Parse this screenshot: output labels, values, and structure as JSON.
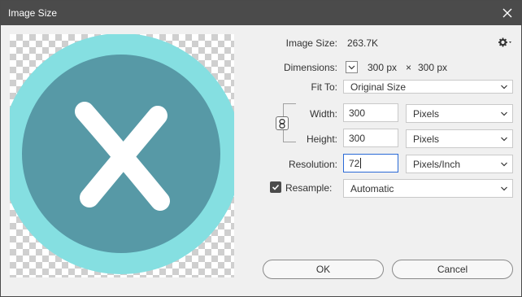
{
  "window": {
    "title": "Image Size"
  },
  "image_size": {
    "label": "Image Size:",
    "value": "263.7K"
  },
  "dimensions": {
    "label": "Dimensions:",
    "width": "300 px",
    "separator": "×",
    "height": "300 px"
  },
  "fit_to": {
    "label": "Fit To:",
    "value": "Original Size"
  },
  "width": {
    "label": "Width:",
    "value": "300",
    "unit": "Pixels"
  },
  "height": {
    "label": "Height:",
    "value": "300",
    "unit": "Pixels"
  },
  "resolution": {
    "label": "Resolution:",
    "value": "72",
    "unit": "Pixels/Inch"
  },
  "resample": {
    "label": "Resample:",
    "checked": true,
    "value": "Automatic"
  },
  "buttons": {
    "ok": "OK",
    "cancel": "Cancel"
  },
  "colors": {
    "titlebar": "#4b4b4b",
    "circle_outer": "#85dfe1",
    "circle_inner": "#5799a6",
    "x_mark": "#ffffff",
    "focus_border": "#2a6ad6"
  },
  "icons": {
    "close": "close-icon",
    "gear": "gear-icon",
    "chain": "chain-link-icon",
    "check": "checkmark-icon",
    "chevron": "chevron-down-icon"
  }
}
